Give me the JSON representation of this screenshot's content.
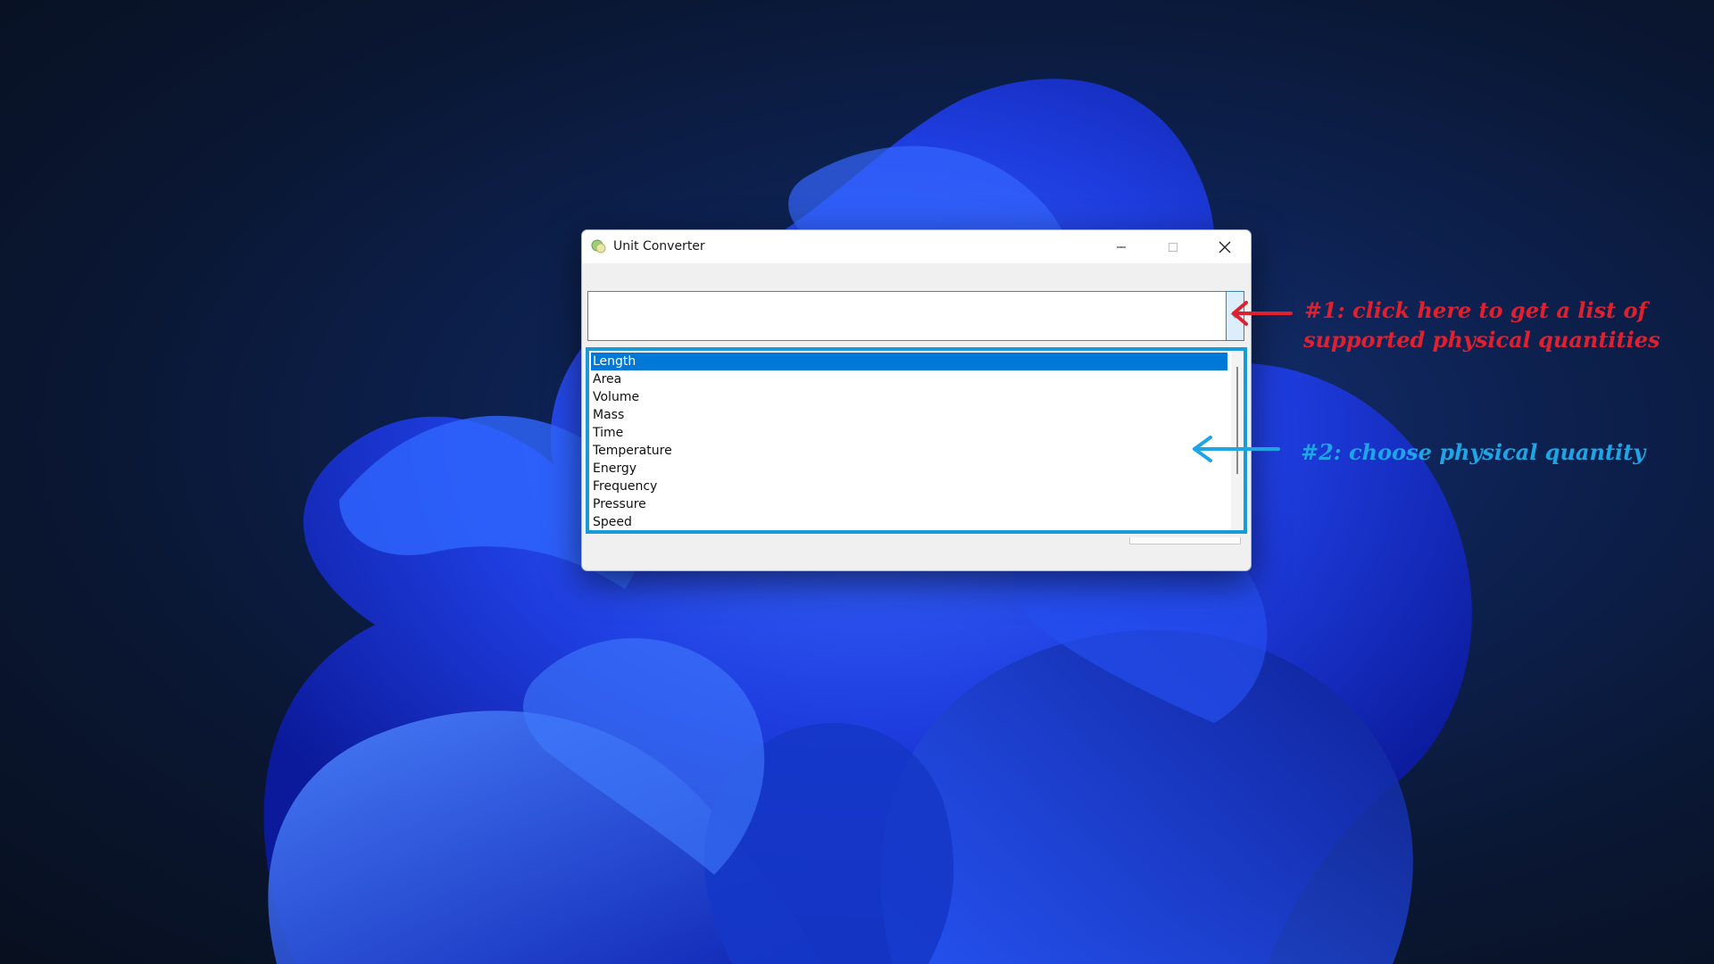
{
  "window": {
    "title": "Unit Converter"
  },
  "title_buttons": {
    "minimize_icon": "minimize-icon",
    "maximize_icon": "maximize-icon",
    "close_icon": "close-icon"
  },
  "combo": {
    "value": "",
    "button_icon": "chevron-down-icon"
  },
  "dropdown": {
    "items": [
      "Length",
      "Area",
      "Volume",
      "Mass",
      "Time",
      "Temperature",
      "Energy",
      "Frequency",
      "Pressure",
      "Speed"
    ],
    "selected": "Length"
  },
  "annotations": {
    "step1_line1": "#1: click here to get a list of",
    "step1_line2": "supported physical quantities",
    "step2": "#2: choose physical quantity"
  },
  "colors": {
    "annotation_red": "#e0202e",
    "annotation_blue": "#1ea5e6",
    "selection": "#0078d7",
    "highlight_border": "#1a9ad6"
  }
}
